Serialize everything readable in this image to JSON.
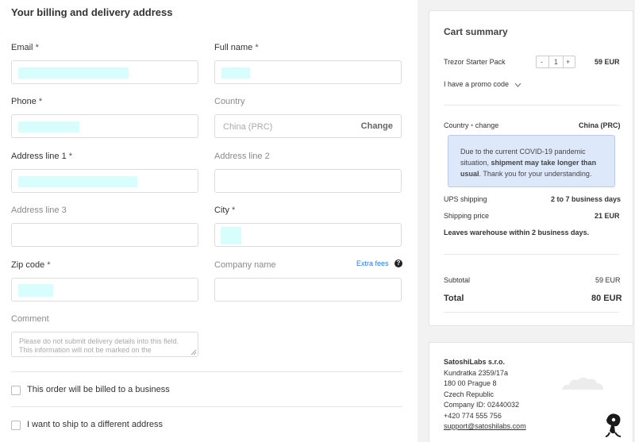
{
  "form": {
    "title": "Your billing and delivery address",
    "email_label": "Email",
    "fullname_label": "Full name",
    "phone_label": "Phone",
    "country_label": "Country",
    "country_value": "China (PRC)",
    "country_change": "Change",
    "address1_label": "Address line 1",
    "address2_label": "Address line 2",
    "address3_label": "Address line 3",
    "city_label": "City",
    "zip_label": "Zip code",
    "company_label": "Company name",
    "extra_fees": "Extra fees",
    "help_glyph": "?",
    "required_mark": "*",
    "comment_label": "Comment",
    "comment_placeholder": "Please do not submit delivery details into this field. This information will not be marked on the",
    "business_checkbox": "This order will be billed to a business",
    "ship_different_checkbox": "I want to ship to a different address",
    "field_fill_color": "#d7fdfd"
  },
  "cart": {
    "title": "Cart summary",
    "product": "Trezor Starter Pack",
    "quantity": "1",
    "qty_minus": "-",
    "qty_plus": "+",
    "product_price": "59 EUR",
    "promo": "I have a promo code",
    "country_label": "Country",
    "country_change": "change",
    "country_value": "China (PRC)",
    "notice_pre": "Due to the current COVID-19 pandemic situation, ",
    "notice_bold": "shipment may take longer than usual",
    "notice_post": ". Thank you for your understanding.",
    "ups_label": "UPS shipping",
    "ups_value": "2 to 7 business days",
    "shipping_price_label": "Shipping price",
    "shipping_price_value": "21 EUR",
    "leaves": "Leaves warehouse within 2 business days.",
    "subtotal_label": "Subtotal",
    "subtotal_value": "59 EUR",
    "total_label": "Total",
    "total_value": "80 EUR"
  },
  "company": {
    "name": "SatoshiLabs s.r.o.",
    "street": "Kundratka 2359/17a",
    "city": "180 00 Prague 8",
    "country": "Czech Republic",
    "company_id": "Company ID: 02440032",
    "phone": "+420 774 555 756",
    "email": "support@satoshilabs.com"
  }
}
